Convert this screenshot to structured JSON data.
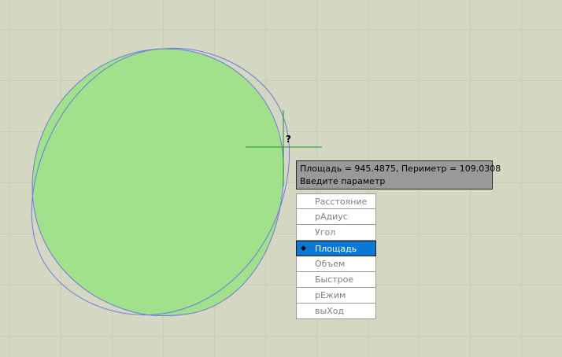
{
  "tooltip": {
    "line1": "Площадь = 945.4875, Периметр = 109.0308",
    "line2": "Введите параметр"
  },
  "menu": {
    "items": [
      {
        "label": "Расстояние",
        "selected": false
      },
      {
        "label": "рАдиус",
        "selected": false
      },
      {
        "label": "Угол",
        "selected": false
      },
      {
        "label": "Площадь",
        "selected": true
      },
      {
        "label": "Объем",
        "selected": false
      },
      {
        "label": "Быстрое",
        "selected": false
      },
      {
        "label": "рЕжим",
        "selected": false
      },
      {
        "label": "выХод",
        "selected": false
      }
    ],
    "selected_marker": "◆"
  },
  "cursor": {
    "icon": "question-mark-icon",
    "glyph": "?"
  },
  "colors": {
    "background": "#d4d7c1",
    "fill": "#a1e18c",
    "outline": "#6f78e0",
    "crosshair": "#199a22",
    "menu_selected": "#0a78d6",
    "tooltip_bg": "#999999"
  }
}
